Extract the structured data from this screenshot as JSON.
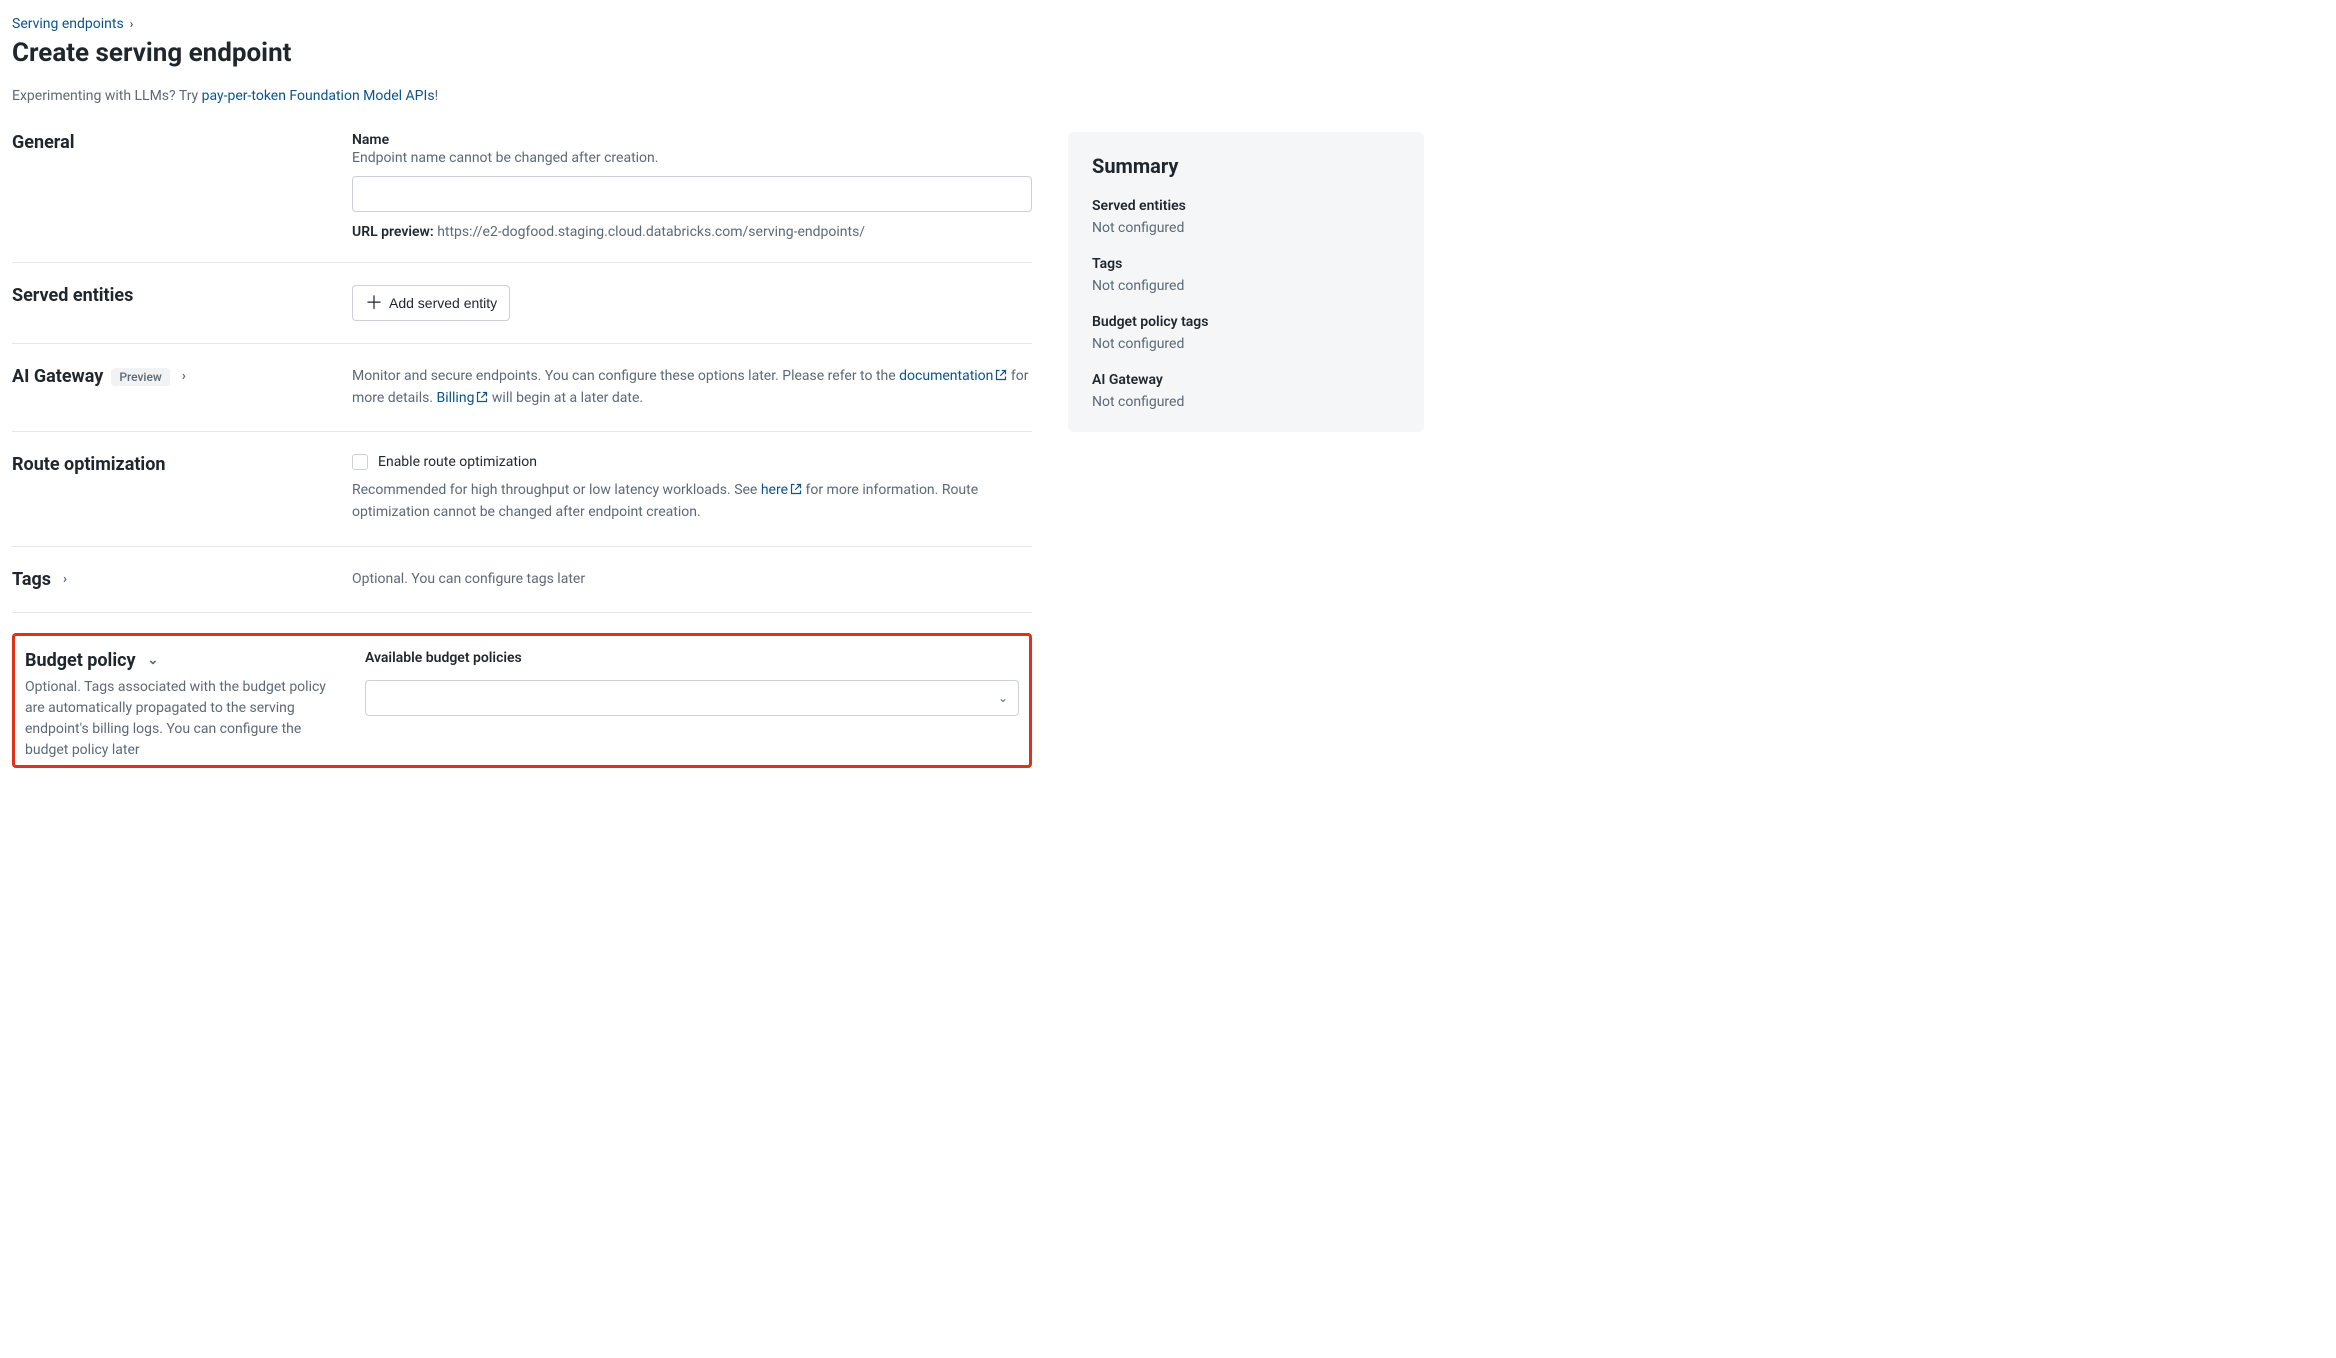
{
  "breadcrumb": {
    "link": "Serving endpoints"
  },
  "page_title": "Create serving endpoint",
  "subtext": {
    "prefix": "Experimenting with LLMs? Try ",
    "link": "pay-per-token Foundation Model APIs",
    "suffix": "!"
  },
  "general": {
    "heading": "General",
    "name_label": "Name",
    "name_hint": "Endpoint name cannot be changed after creation.",
    "name_value": "",
    "url_preview_label": "URL preview:",
    "url_preview_value": "https://e2-dogfood.staging.cloud.databricks.com/serving-endpoints/"
  },
  "served_entities": {
    "heading": "Served entities",
    "add_button": "Add served entity"
  },
  "ai_gateway": {
    "heading": "AI Gateway",
    "badge": "Preview",
    "desc_1": "Monitor and secure endpoints. You can configure these options later. Please refer to the ",
    "doc_link": "documentation",
    "desc_2": " for more details. ",
    "billing_link": "Billing",
    "desc_3": " will begin at a later date."
  },
  "route_optimization": {
    "heading": "Route optimization",
    "checkbox_label": "Enable route optimization",
    "desc_1": "Recommended for high throughput or low latency workloads. See ",
    "here_link": "here",
    "desc_2": " for more information. Route optimization cannot be changed after endpoint creation."
  },
  "tags": {
    "heading": "Tags",
    "desc": "Optional. You can configure tags later"
  },
  "budget_policy": {
    "heading": "Budget policy",
    "desc": "Optional. Tags associated with the budget policy are automatically propagated to the serving endpoint's billing logs. You can configure the budget policy later",
    "field_label": "Available budget policies",
    "selected": ""
  },
  "summary": {
    "heading": "Summary",
    "items": [
      {
        "label": "Served entities",
        "value": "Not configured"
      },
      {
        "label": "Tags",
        "value": "Not configured"
      },
      {
        "label": "Budget policy tags",
        "value": "Not configured"
      },
      {
        "label": "AI Gateway",
        "value": "Not configured"
      }
    ]
  }
}
